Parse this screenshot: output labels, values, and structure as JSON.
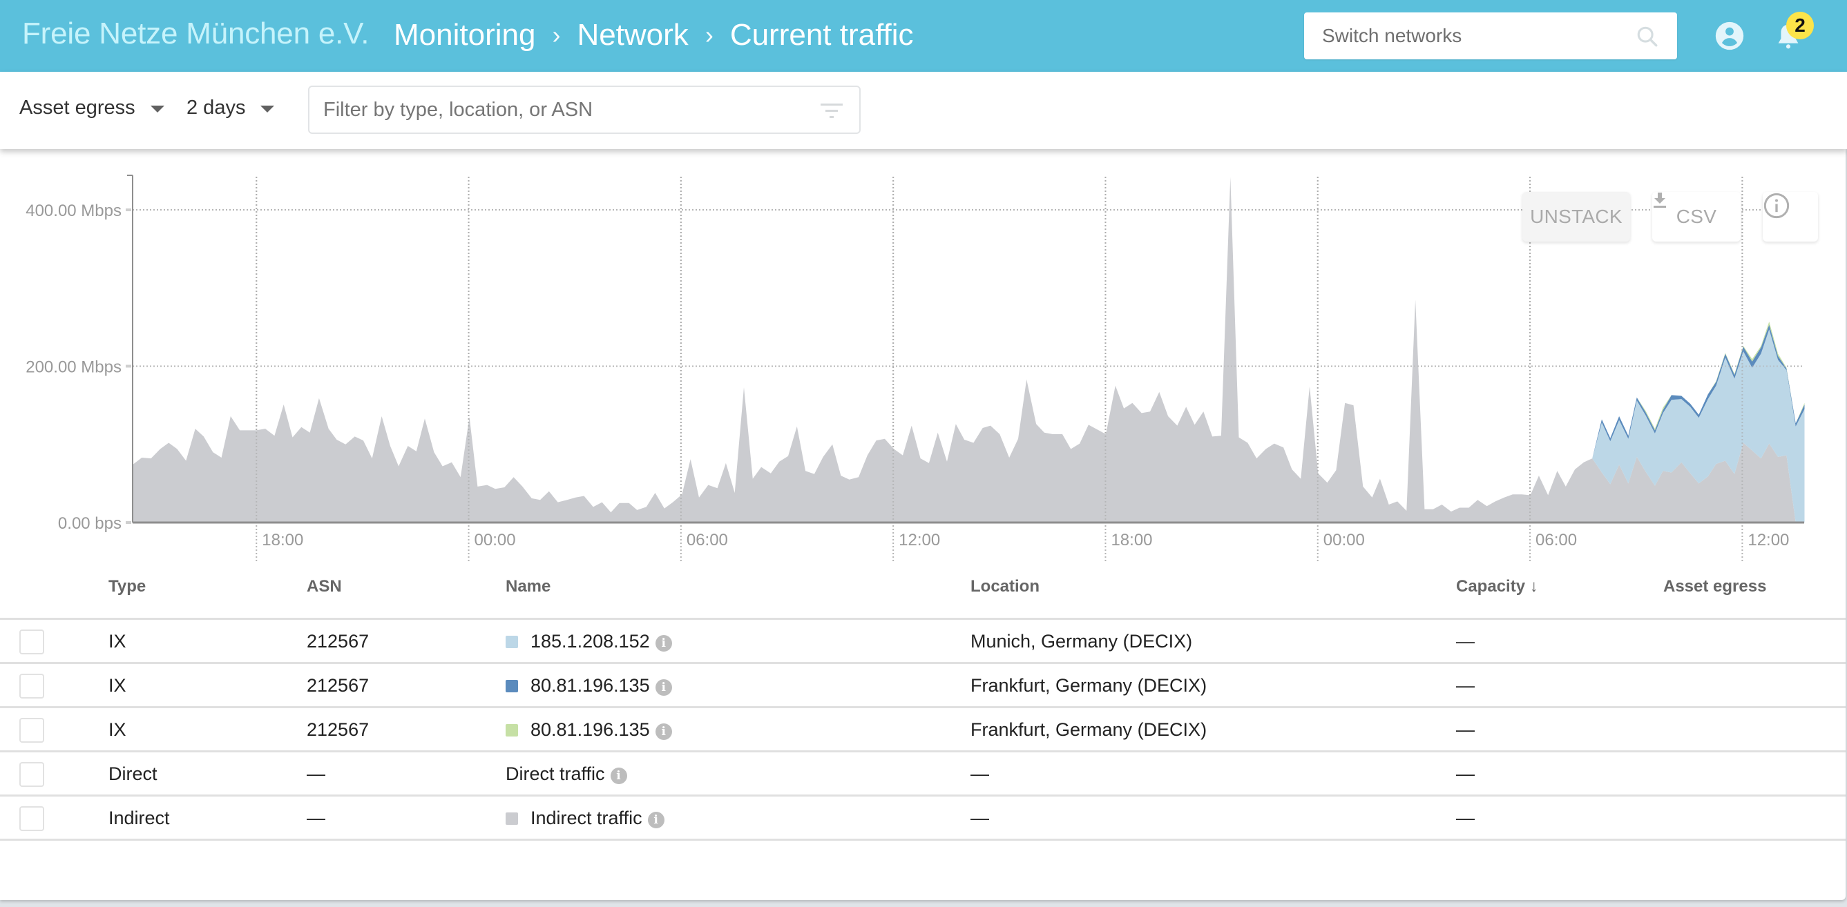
{
  "header": {
    "org_name": "Freie Netze München e.V.",
    "breadcrumbs": [
      "Monitoring",
      "Network",
      "Current traffic"
    ],
    "separator": "›",
    "search_placeholder": "Switch networks",
    "notification_count": "2",
    "colors": {
      "bar": "#5bc0dc",
      "badge": "#fce449"
    }
  },
  "toolbar": {
    "metric_select": "Asset egress",
    "range_select": "2 days",
    "filter_placeholder": "Filter by type, location, or ASN"
  },
  "chart_buttons": {
    "unstack": "UNSTACK",
    "csv": "CSV"
  },
  "chart_data": {
    "type": "area",
    "stacked": true,
    "title": "",
    "xlabel": "",
    "ylabel": "",
    "x_unit": "hours since chart start (14:30)",
    "x_range": [
      0,
      47.3
    ],
    "ylim": [
      0,
      440
    ],
    "y_unit": "Mbps",
    "y_ticks": [
      {
        "value": 0,
        "label": "0.00 bps"
      },
      {
        "value": 200,
        "label": "200.00 Mbps"
      },
      {
        "value": 400,
        "label": "400.00 Mbps"
      }
    ],
    "x_ticks": [
      {
        "value": 3.5,
        "label": "18:00"
      },
      {
        "value": 9.5,
        "label": "00:00"
      },
      {
        "value": 15.5,
        "label": "06:00"
      },
      {
        "value": 21.5,
        "label": "12:00"
      },
      {
        "value": 27.5,
        "label": "18:00"
      },
      {
        "value": 33.5,
        "label": "00:00"
      },
      {
        "value": 39.5,
        "label": "06:00"
      },
      {
        "value": 45.5,
        "label": "12:00"
      }
    ],
    "grid": true,
    "series": [
      {
        "name": "Indirect traffic",
        "color": "#cbccd0",
        "x": [
          0,
          0.26,
          0.52,
          0.78,
          1.02,
          1.26,
          1.51,
          1.77,
          2.01,
          2.27,
          2.51,
          2.77,
          3.03,
          3.49,
          3.75,
          4.01,
          4.27,
          4.52,
          4.77,
          5.01,
          5.27,
          5.54,
          5.77,
          6.02,
          6.28,
          6.52,
          6.77,
          7.04,
          7.28,
          7.52,
          7.78,
          8.02,
          8.26,
          8.52,
          8.76,
          9.02,
          9.27,
          9.52,
          9.75,
          10.02,
          10.25,
          10.51,
          10.77,
          11.02,
          11.28,
          11.52,
          11.77,
          12.02,
          12.28,
          12.52,
          12.76,
          13.02,
          13.27,
          13.52,
          13.76,
          14.03,
          14.26,
          14.52,
          14.77,
          15.03,
          15.27,
          15.53,
          15.77,
          16.01,
          16.27,
          16.53,
          16.77,
          17.02,
          17.28,
          17.53,
          17.77,
          18.04,
          18.28,
          18.53,
          18.78,
          19.02,
          19.27,
          19.52,
          19.78,
          20.02,
          20.26,
          20.52,
          20.77,
          21.02,
          21.26,
          21.52,
          21.77,
          22.02,
          22.27,
          22.51,
          22.76,
          23.02,
          23.27,
          23.51,
          23.77,
          24.03,
          24.25,
          24.51,
          24.78,
          25.03,
          25.27,
          25.54,
          25.77,
          26.01,
          26.28,
          26.52,
          26.77,
          27.02,
          27.51,
          27.78,
          28.02,
          28.26,
          28.52,
          28.76,
          29.02,
          29.27,
          29.53,
          29.78,
          30.02,
          30.27,
          30.52,
          30.77,
          31.03,
          31.27,
          31.52,
          31.77,
          32.03,
          32.27,
          32.53,
          32.77,
          33.02,
          33.27,
          33.51,
          33.77,
          34.02,
          34.27,
          34.51,
          34.78,
          35.04,
          35.26,
          35.51,
          35.75,
          36.01,
          36.26,
          36.52,
          36.76,
          37.01,
          37.27,
          37.51,
          37.77,
          38.02,
          38.28,
          38.52,
          38.77,
          39.01,
          39.27,
          39.51,
          39.75,
          40.01,
          40.27,
          40.51,
          40.77,
          41.02,
          41.26,
          41.53,
          41.77,
          42.02,
          42.28,
          42.52,
          42.77,
          43.03,
          43.26,
          43.5,
          43.78,
          44.03,
          44.27,
          44.53,
          44.76,
          45.02,
          45.28,
          45.53,
          45.78,
          46.03,
          46.26,
          46.51,
          46.75,
          47.01,
          47.26
        ],
        "values": [
          74,
          83,
          82,
          94,
          102,
          94,
          79,
          120,
          110,
          90,
          83,
          136,
          118,
          118,
          120,
          111,
          151,
          109,
          122,
          115,
          159,
          120,
          106,
          100,
          110,
          105,
          82,
          136,
          98,
          72,
          98,
          91,
          133,
          90,
          72,
          77,
          58,
          135,
          46,
          48,
          43,
          45,
          58,
          46,
          31,
          29,
          40,
          26,
          29,
          32,
          34,
          20,
          26,
          13,
          25,
          25,
          16,
          20,
          38,
          18,
          26,
          36,
          81,
          32,
          48,
          44,
          76,
          38,
          173,
          56,
          71,
          63,
          78,
          85,
          123,
          66,
          62,
          84,
          100,
          60,
          55,
          58,
          86,
          105,
          107,
          94,
          86,
          124,
          82,
          76,
          115,
          78,
          126,
          106,
          102,
          121,
          124,
          113,
          83,
          107,
          183,
          126,
          115,
          113,
          113,
          94,
          101,
          125,
          113,
          175,
          146,
          153,
          140,
          142,
          167,
          136,
          124,
          148,
          125,
          142,
          110,
          111,
          442,
          109,
          102,
          82,
          94,
          101,
          96,
          68,
          56,
          174,
          63,
          51,
          67,
          153,
          150,
          46,
          32,
          56,
          23,
          27,
          15,
          285,
          17,
          17,
          23,
          14,
          19,
          19,
          29,
          21,
          27,
          32,
          36,
          36,
          35,
          60,
          35,
          66,
          46,
          68,
          77,
          82,
          64,
          49,
          74,
          50,
          84,
          65,
          47,
          66,
          64,
          77,
          63,
          50,
          59,
          75,
          79,
          62,
          102,
          92,
          82,
          101,
          84,
          86,
          0,
          0,
          0
        ]
      },
      {
        "name": "185.1.208.152",
        "color": "#bcd7e7",
        "x": [
          41.0,
          41.26,
          41.53,
          41.77,
          42.02,
          42.28,
          42.52,
          42.77,
          43.03,
          43.26,
          43.5,
          43.78,
          44.03,
          44.27,
          44.53,
          44.76,
          45.02,
          45.28,
          45.53,
          45.78,
          46.03,
          46.26,
          46.51,
          46.75,
          47.01,
          47.26
        ],
        "values": [
          0,
          0,
          64,
          55,
          57,
          57,
          72,
          72,
          67,
          74,
          93,
          81,
          85,
          84,
          99,
          100,
          132,
          122,
          117,
          106,
          134,
          146,
          124,
          109,
          123,
          145
        ]
      },
      {
        "name": "80.81.196.135",
        "color": "#5b8bbd",
        "x": [
          41.0,
          41.26,
          41.53,
          41.77,
          42.02,
          42.28,
          42.52,
          42.77,
          43.03,
          43.26,
          43.5,
          43.78,
          44.03,
          44.27,
          44.53,
          44.76,
          45.02,
          45.28,
          45.53,
          45.78,
          46.03,
          46.26,
          46.51,
          46.75,
          47.01,
          47.26
        ],
        "values": [
          0,
          0,
          4,
          4,
          5,
          4,
          4,
          4,
          4,
          4,
          6,
          4,
          4,
          4,
          6,
          5,
          5,
          5,
          6,
          8,
          8,
          6,
          5,
          2,
          4,
          6
        ]
      },
      {
        "name": "80.81.196.135",
        "color": "#c6e0a5",
        "x": [
          41.0,
          41.26,
          41.53,
          41.77,
          42.02,
          42.28,
          42.52,
          42.77,
          43.03,
          43.26,
          43.5,
          43.78,
          44.03,
          44.27,
          44.53,
          44.76,
          45.02,
          45.28,
          45.53,
          45.78,
          46.03,
          46.26,
          46.51,
          46.75,
          47.01,
          47.26
        ],
        "values": [
          0,
          0,
          0,
          0,
          0,
          0,
          0,
          2,
          2,
          3,
          0,
          0,
          0,
          0,
          0,
          1,
          1,
          1,
          1,
          3,
          2,
          4,
          3,
          1,
          0,
          2
        ]
      }
    ]
  },
  "table": {
    "columns": [
      "Type",
      "ASN",
      "Name",
      "Location",
      "Capacity",
      "Asset egress"
    ],
    "sort_column": "Capacity",
    "sort_direction": "descending",
    "rows": [
      {
        "type": "IX",
        "asn": "212567",
        "name": "185.1.208.152",
        "swatch": "#bcd7e7",
        "location": "Munich, Germany (DECIX)",
        "capacity": "—",
        "egress": ""
      },
      {
        "type": "IX",
        "asn": "212567",
        "name": "80.81.196.135",
        "swatch": "#5b8bbd",
        "location": "Frankfurt, Germany (DECIX)",
        "capacity": "—",
        "egress": ""
      },
      {
        "type": "IX",
        "asn": "212567",
        "name": "80.81.196.135",
        "swatch": "#c6e0a5",
        "location": "Frankfurt, Germany (DECIX)",
        "capacity": "—",
        "egress": ""
      },
      {
        "type": "Direct",
        "asn": "—",
        "name": "Direct traffic",
        "swatch": "",
        "location": "—",
        "capacity": "—",
        "egress": ""
      },
      {
        "type": "Indirect",
        "asn": "—",
        "name": "Indirect traffic",
        "swatch": "#cbccd0",
        "location": "—",
        "capacity": "—",
        "egress": ""
      }
    ]
  }
}
